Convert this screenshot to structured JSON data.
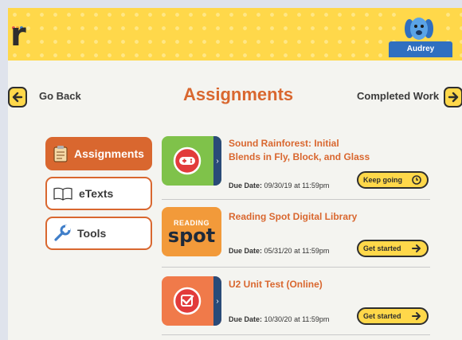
{
  "header": {
    "logo_letter": "r",
    "logo_dot_colors": [
      "#e8544a",
      "#f2a431",
      "#3f7ec9",
      "#58b548"
    ],
    "user_name": "Audrey"
  },
  "nav": {
    "back_label": "Go Back",
    "title": "Assignments",
    "completed_label": "Completed Work"
  },
  "sidebar": {
    "items": [
      {
        "label": "Assignments",
        "icon": "clipboard-icon",
        "active": true
      },
      {
        "label": "eTexts",
        "icon": "open-book-icon",
        "active": false
      },
      {
        "label": "Tools",
        "icon": "wrench-icon",
        "active": false
      }
    ]
  },
  "assignments": [
    {
      "title": "Sound Rainforest: Initial Blends in Fly, Block, and Glass",
      "due_prefix": "Due Date:",
      "due_date": "09/30/19 at 11:59pm",
      "action": "Keep going",
      "icon": "game-controller-icon"
    },
    {
      "title": "Reading Spot Digital Library",
      "due_prefix": "Due Date:",
      "due_date": "05/31/20 at 11:59pm",
      "action": "Get started",
      "icon": "reading-spot-logo",
      "logo_top": "READING",
      "logo_bottom": "spot"
    },
    {
      "title": "U2 Unit Test (Online)",
      "due_prefix": "Due Date:",
      "due_date": "10/30/20 at 11:59pm",
      "action": "Get started",
      "icon": "checkbox-icon"
    }
  ],
  "colors": {
    "accent": "#d9672f",
    "header_yellow": "#ffd84a",
    "user_tag_blue": "#2f6fc0",
    "card_green": "#7fc24a",
    "card_orange": "#f29a3a",
    "card_red_orange": "#f07a4a",
    "strip_navy": "#2a4b78"
  }
}
